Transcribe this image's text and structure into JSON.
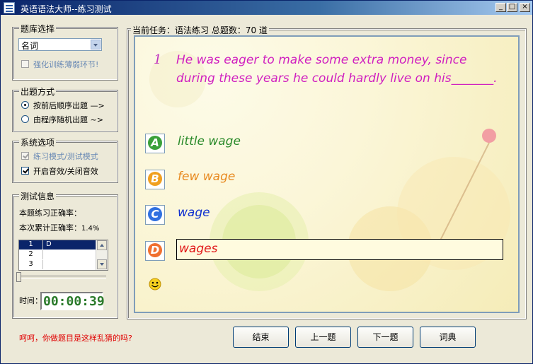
{
  "window": {
    "title": "英语语法大师--练习测试"
  },
  "title_buttons": {
    "minimize": "_",
    "maximize": "□",
    "close": "×"
  },
  "left": {
    "bank": {
      "label": "题库选择",
      "selected": "名词",
      "reinforce": {
        "label": "强化训练薄弱环节!",
        "checked": false,
        "disabled": true
      }
    },
    "order": {
      "label": "出题方式",
      "options": [
        {
          "label": "按前后顺序出题 —>",
          "selected": true
        },
        {
          "label": "由程序随机出题 ~>",
          "selected": false
        }
      ]
    },
    "system": {
      "label": "系统选项",
      "options": [
        {
          "label": "练习模式/测试模式",
          "checked": true,
          "disabled": true
        },
        {
          "label": "开启音效/关闭音效",
          "checked": true,
          "disabled": false
        }
      ]
    },
    "info": {
      "label": "测试信息",
      "accuracy_label": "本题练习正确率：",
      "cumulative_label": "本次累计正确率：",
      "cumulative_value": "1.4%",
      "rows": [
        {
          "n": "1",
          "a": "D"
        },
        {
          "n": "2",
          "a": ""
        },
        {
          "n": "3",
          "a": ""
        }
      ],
      "time_label": "时间：",
      "time_value": "00:00:39"
    }
  },
  "main": {
    "header": "当前任务：语法练习  总题数：70 道",
    "question_number": "1",
    "question_text": "He was eager to make some extra money, since during these years he could hardly live on his_______.",
    "options": [
      {
        "letter": "A",
        "text": "little wage",
        "color": "#2a8a2a",
        "icon_color": "#3aa03a"
      },
      {
        "letter": "B",
        "text": "few wage",
        "color": "#e88a20",
        "icon_color": "#f0a020"
      },
      {
        "letter": "C",
        "text": "wage",
        "color": "#1030d0",
        "icon_color": "#3070e0"
      },
      {
        "letter": "D",
        "text": "wages",
        "color": "#e01818",
        "icon_color": "#f07030"
      }
    ]
  },
  "status_text": "呵呵，你做题目是这样乱猜的吗?",
  "buttons": {
    "end": "结束",
    "prev": "上一题",
    "next": "下一题",
    "dict": "词典"
  }
}
